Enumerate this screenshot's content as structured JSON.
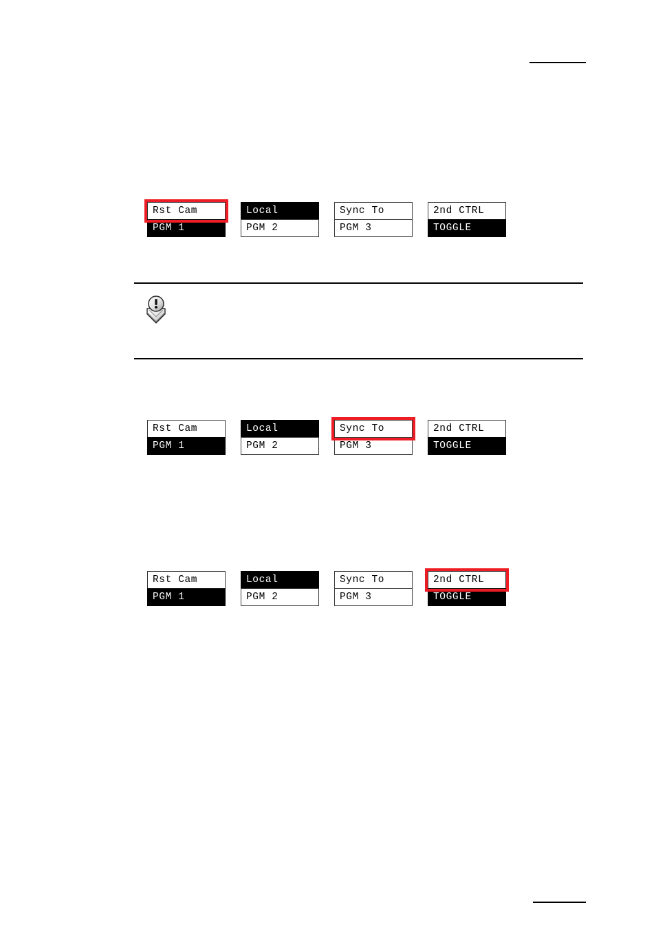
{
  "page": {
    "background_color": "#ffffff",
    "highlight_color": "#ee1c25",
    "lcd_on_color": "#000000",
    "lcd_off_color": "#ffffff"
  },
  "header": {
    "rule": ""
  },
  "footer": {
    "rule": ""
  },
  "note": {
    "icon_name": "note-exclamation-icon",
    "text": ""
  },
  "lcd_groups": [
    {
      "id": "group-1",
      "highlighted_cell": 0,
      "highlighted_row": "top",
      "cells": [
        {
          "top_label": "Rst Cam",
          "top_state": "off",
          "bottom_label": "PGM 1",
          "bottom_state": "on"
        },
        {
          "top_label": "Local",
          "top_state": "on",
          "bottom_label": "PGM 2",
          "bottom_state": "off"
        },
        {
          "top_label": "Sync To",
          "top_state": "off",
          "bottom_label": "PGM 3",
          "bottom_state": "off"
        },
        {
          "top_label": "2nd CTRL",
          "top_state": "off",
          "bottom_label": "TOGGLE",
          "bottom_state": "on"
        }
      ]
    },
    {
      "id": "group-2",
      "highlighted_cell": 2,
      "highlighted_row": "top",
      "cells": [
        {
          "top_label": "Rst Cam",
          "top_state": "off",
          "bottom_label": "PGM 1",
          "bottom_state": "on"
        },
        {
          "top_label": "Local",
          "top_state": "on",
          "bottom_label": "PGM 2",
          "bottom_state": "off"
        },
        {
          "top_label": "Sync To",
          "top_state": "off",
          "bottom_label": "PGM 3",
          "bottom_state": "off"
        },
        {
          "top_label": "2nd CTRL",
          "top_state": "off",
          "bottom_label": "TOGGLE",
          "bottom_state": "on"
        }
      ]
    },
    {
      "id": "group-3",
      "highlighted_cell": 3,
      "highlighted_row": "top",
      "cells": [
        {
          "top_label": "Rst Cam",
          "top_state": "off",
          "bottom_label": "PGM 1",
          "bottom_state": "on"
        },
        {
          "top_label": "Local",
          "top_state": "on",
          "bottom_label": "PGM 2",
          "bottom_state": "off"
        },
        {
          "top_label": "Sync To",
          "top_state": "off",
          "bottom_label": "PGM 3",
          "bottom_state": "off"
        },
        {
          "top_label": "2nd CTRL",
          "top_state": "off",
          "bottom_label": "TOGGLE",
          "bottom_state": "on"
        }
      ]
    }
  ]
}
